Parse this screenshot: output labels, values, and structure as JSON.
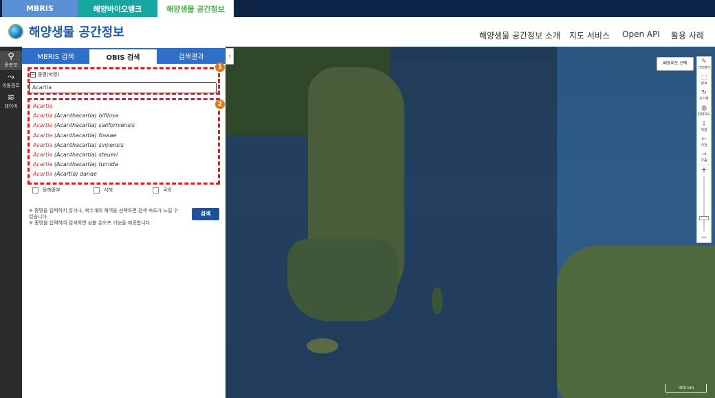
{
  "top_tabs": [
    "MBRIS",
    "해양바이오뱅크",
    "해양생물 공간정보"
  ],
  "site": {
    "title": "해양생물 공간정보"
  },
  "nav": [
    "해양생물 공간정보 소개",
    "지도 서비스",
    "Open API",
    "활용 사례"
  ],
  "rail": [
    {
      "label": "종분포",
      "icon": "species-distribution-icon"
    },
    {
      "label": "이동경로",
      "icon": "route-icon"
    },
    {
      "label": "레이어",
      "icon": "layers-icon"
    }
  ],
  "panel_tabs": [
    "MBRIS 검색",
    "OBIS 검색",
    "검색결과"
  ],
  "search": {
    "label": "종명(학명)",
    "value": "Acartia"
  },
  "suggestions": [
    {
      "genus": "Acartia",
      "rest": ""
    },
    {
      "genus": "Acartia",
      "rest": " (Acanthacartia) bifilosa"
    },
    {
      "genus": "Acartia",
      "rest": " (Acanthacartia) californiensis"
    },
    {
      "genus": "Acartia",
      "rest": " (Acanthacartia) fossae"
    },
    {
      "genus": "Acartia",
      "rest": " (Acanthacartia) sinjiensis"
    },
    {
      "genus": "Acartia",
      "rest": " (Acanthacartia) steueri"
    },
    {
      "genus": "Acartia",
      "rest": " (Acanthacartia) tumida"
    },
    {
      "genus": "Acartia",
      "rest": " (Acartia) danae"
    }
  ],
  "regions": [
    "동해중부",
    "서해",
    "국외"
  ],
  "notes": [
    "※ 종명을 입력하지 않거나, 복수개의 해역을 선택하면 검색 속도가 느릴 수 있습니다.",
    "※ 종명을 입력하여 검색하면 심볼 온오프 기능을 제공합니다."
  ],
  "search_button": "검색",
  "badges": [
    "1",
    "2"
  ],
  "map": {
    "bg_button": "배경지도 선택",
    "tools": [
      {
        "label": "거리재기",
        "icon": "ruler-icon"
      },
      {
        "label": "면적",
        "icon": "area-icon"
      },
      {
        "label": "초기화",
        "icon": "reset-icon"
      },
      {
        "label": "전체지도",
        "icon": "globe-icon"
      },
      {
        "label": "저장",
        "icon": "save-icon"
      },
      {
        "label": "이전",
        "icon": "prev-icon"
      },
      {
        "label": "다음",
        "icon": "next-icon"
      }
    ],
    "scale": "300 km"
  },
  "colors": {
    "accent": "#2f6fc9",
    "highlight": "#d81f26",
    "badge": "#e0781f",
    "nav_bg": "#0e2446"
  }
}
